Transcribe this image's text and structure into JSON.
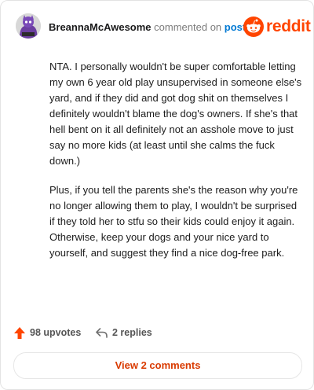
{
  "comment": {
    "username": "BreannaMcAwesome",
    "action_text": "commented on",
    "post_link": "post",
    "paragraphs": [
      "NTA. I personally wouldn't be super comfortable letting my own 6 year old play unsupervised in someone else's yard, and if they did and got dog shit on themselves I definitely wouldn't blame the dog's owners. If she's that hell bent on it all definitely not an asshole move to just say no more kids (at least until she calms the fuck down.)",
      "Plus, if you tell the parents she's the reason why you're no longer allowing them to play, I wouldn't be surprised if they told her to stfu so their kids could enjoy it again. Otherwise, keep your dogs and your nice yard to yourself, and suggest they find a nice dog-free park."
    ]
  },
  "brand": {
    "name": "reddit",
    "icon": "reddit-snoo-icon",
    "color": "#ff4500"
  },
  "actions": {
    "upvotes_label": "98 upvotes",
    "replies_label": "2 replies",
    "upvote_icon": "upvote-arrow-icon",
    "reply_icon": "reply-arrow-icon"
  },
  "footer": {
    "view_comments_label": "View 2 comments"
  },
  "colors": {
    "accent": "#ff4500",
    "link": "#0079d3",
    "button_text": "#d93a00"
  }
}
